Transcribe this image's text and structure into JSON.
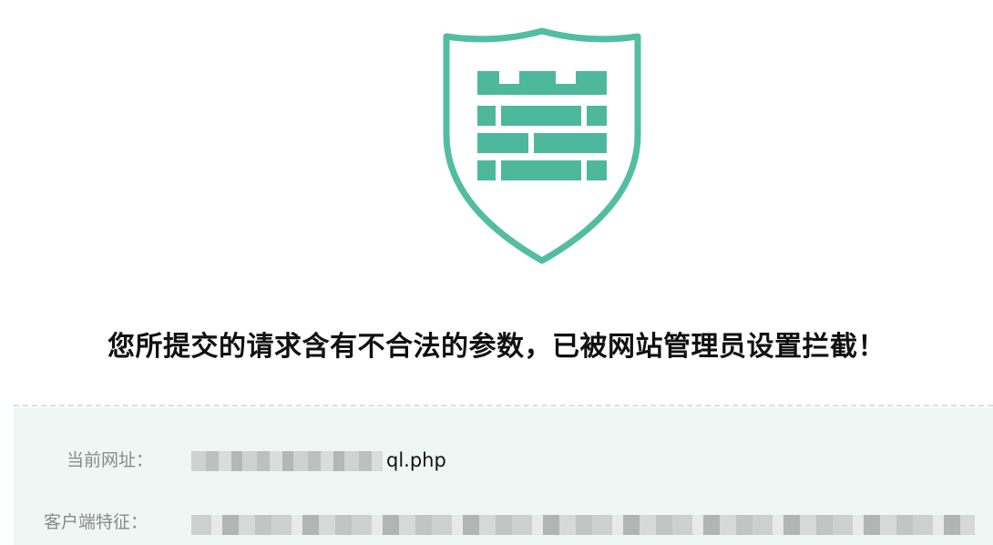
{
  "shield": {
    "icon": "castle-shield-icon",
    "color": "#4db89c",
    "stroke_color": "#52bda1"
  },
  "message": {
    "text": "您所提交的请求含有不合法的参数，已被网站管理员设置拦截！"
  },
  "details": {
    "url_label": "当前网址：",
    "url_value_visible": "ql.php",
    "client_label": "客户端特征：",
    "background_color": "#eef7f4",
    "divider_color": "#d8e0dd"
  }
}
